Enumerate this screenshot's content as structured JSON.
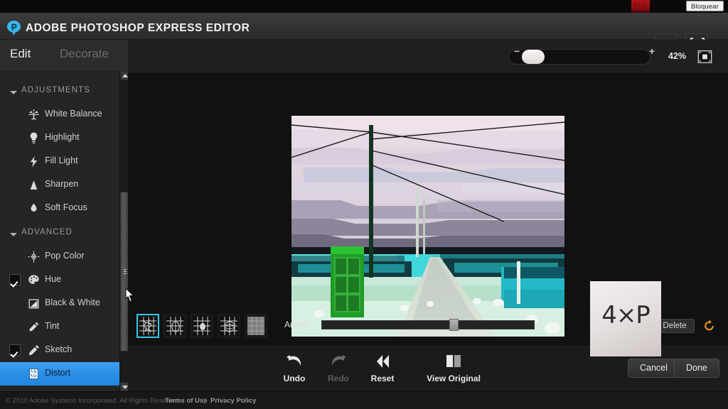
{
  "browser": {
    "block_button": "Bloquear"
  },
  "titlebar": {
    "app_title": "ADOBE PHOTOSHOP EXPRESS EDITOR",
    "logo_icon": "photoshop-express-drop-logo",
    "settings_icon": "gear-icon",
    "fit_icon": "fit-to-window-icon"
  },
  "sidebar": {
    "tabs": [
      {
        "label": "Edit",
        "active": true
      },
      {
        "label": "Decorate",
        "active": false
      }
    ],
    "groups": [
      {
        "label": "ADJUSTMENTS",
        "items": [
          {
            "label": "White Balance",
            "icon": "balance-scale-icon",
            "checked": false,
            "selected": false
          },
          {
            "label": "Highlight",
            "icon": "lightbulb-icon",
            "checked": false,
            "selected": false
          },
          {
            "label": "Fill Light",
            "icon": "lightning-bolt-icon",
            "checked": false,
            "selected": false
          },
          {
            "label": "Sharpen",
            "icon": "triangle-sharpen-icon",
            "checked": false,
            "selected": false
          },
          {
            "label": "Soft Focus",
            "icon": "droplet-icon",
            "checked": false,
            "selected": false
          }
        ]
      },
      {
        "label": "ADVANCED",
        "items": [
          {
            "label": "Pop Color",
            "icon": "target-crosshair-icon",
            "checked": false,
            "selected": false
          },
          {
            "label": "Hue",
            "icon": "color-palette-icon",
            "checked": true,
            "selected": false
          },
          {
            "label": "Black & White",
            "icon": "black-white-square-icon",
            "checked": false,
            "selected": false
          },
          {
            "label": "Tint",
            "icon": "eyedropper-pen-icon",
            "checked": false,
            "selected": false
          },
          {
            "label": "Sketch",
            "icon": "pencil-icon",
            "checked": true,
            "selected": false
          },
          {
            "label": "Distort",
            "icon": "distort-grid-icon",
            "checked": false,
            "selected": true
          }
        ]
      }
    ],
    "scrollbar": {
      "up_icon": "scroll-up-arrow-icon",
      "down_icon": "scroll-down-arrow-icon",
      "thumb_icon": "scrollbar-thumb"
    }
  },
  "zoombar": {
    "minus_label": "−",
    "plus_label": "+",
    "zoom_percent": "42%",
    "fit_screen_icon": "fit-to-screen-icon"
  },
  "options": {
    "presets": [
      {
        "name": "distort-preset-crackle",
        "active": true
      },
      {
        "name": "distort-preset-pinch",
        "active": false
      },
      {
        "name": "distort-preset-bulge",
        "active": false
      },
      {
        "name": "distort-preset-sphere",
        "active": false
      },
      {
        "name": "distort-preset-noise",
        "active": false
      }
    ],
    "angle_label": "Angle:",
    "angle_value_percent": 61,
    "delete_label": "Delete",
    "rotate_icon": "rotate-reset-icon"
  },
  "actions": [
    {
      "label": "Undo",
      "icon": "undo-arrow-icon",
      "disabled": false
    },
    {
      "label": "Redo",
      "icon": "redo-arrow-icon",
      "disabled": true
    },
    {
      "label": "Reset",
      "icon": "double-chevron-left-icon",
      "disabled": false
    },
    {
      "label": "View Original",
      "icon": "split-view-icon",
      "disabled": false
    }
  ],
  "dialog_buttons": {
    "cancel": "Cancel",
    "done": "Done"
  },
  "watermark": {
    "text": "4×P"
  },
  "footer": {
    "copyright": "© 2010 Adobe Systems Incorporated. All Rights Reserved.",
    "terms": "Terms of Use",
    "separator": "|",
    "privacy": "Privacy Policy"
  },
  "canvas": {
    "image_description": "posterized photo of green telephone box beside a country road under a purple cloudy sky"
  }
}
